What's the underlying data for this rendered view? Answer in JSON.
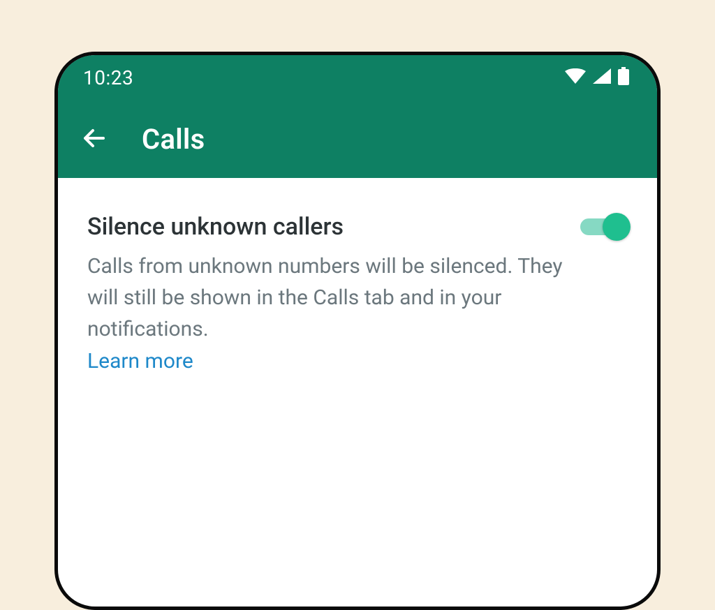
{
  "status": {
    "time": "10:23"
  },
  "header": {
    "title": "Calls"
  },
  "setting": {
    "title": "Silence unknown callers",
    "description": "Calls from unknown numbers will be silenced. They will still be shown in the Calls tab and in your notifications.",
    "learn_more": "Learn more",
    "enabled": true
  },
  "colors": {
    "brand": "#0e8063",
    "accent": "#1fbf8f",
    "accent_track": "#86d9c3",
    "link": "#1e88c9",
    "text_primary": "#2c3336",
    "text_secondary": "#6b777d",
    "page_bg": "#f8eedd"
  }
}
